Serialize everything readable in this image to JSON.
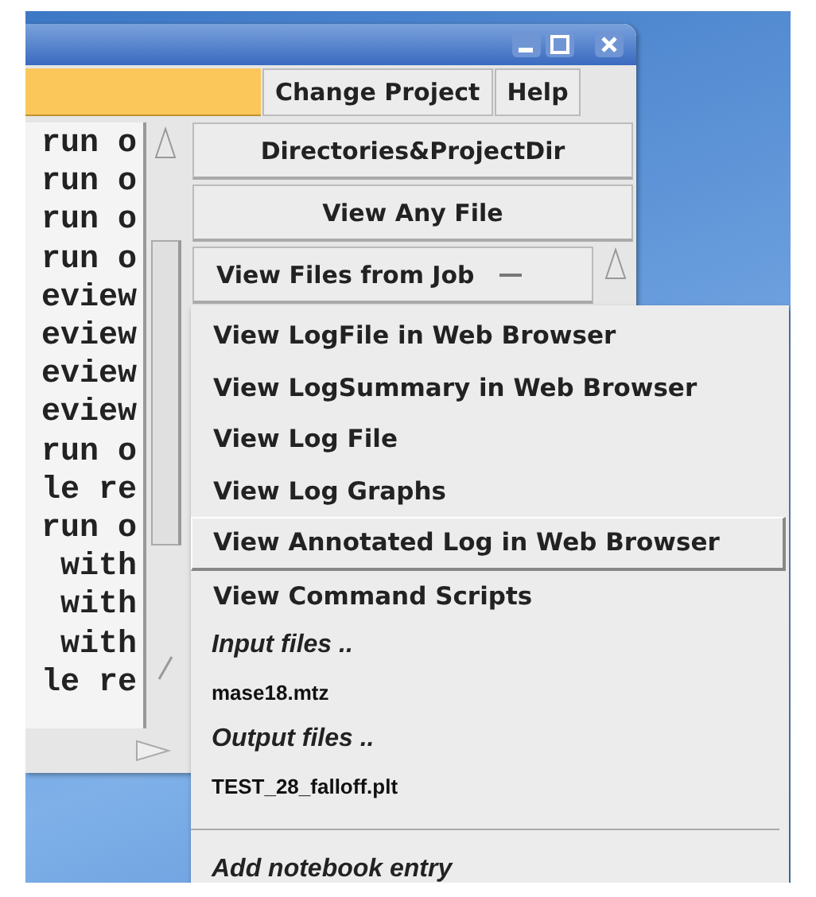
{
  "window": {
    "menu_bar": [
      {
        "label": "Change Project"
      },
      {
        "label": "Help"
      }
    ],
    "log_lines": [
      "run o",
      "run o",
      "run o",
      "run o",
      "eview",
      "eview",
      "eview",
      "eview",
      "run o",
      "le re",
      "run o",
      "with",
      "with",
      "with",
      "le re"
    ],
    "buttons": [
      {
        "label": "Directories&ProjectDir"
      },
      {
        "label": "View Any File"
      }
    ],
    "dropdown": {
      "label": "View Files from Job",
      "expanded": true
    }
  },
  "popup_menu": {
    "items": [
      {
        "kind": "item",
        "label": "View LogFile in Web Browser",
        "selected": false
      },
      {
        "kind": "item",
        "label": "View LogSummary in Web Browser",
        "selected": false
      },
      {
        "kind": "item",
        "label": "View Log File",
        "selected": false
      },
      {
        "kind": "item",
        "label": "View Log Graphs",
        "selected": false
      },
      {
        "kind": "item",
        "label": "View Annotated Log in Web Browser",
        "selected": true
      },
      {
        "kind": "item",
        "label": "View Command Scripts",
        "selected": false
      },
      {
        "kind": "heading",
        "label": "Input files .."
      },
      {
        "kind": "file",
        "label": "mase18.mtz"
      },
      {
        "kind": "heading",
        "label": "Output files .."
      },
      {
        "kind": "file",
        "label": "TEST_28_falloff.plt"
      },
      {
        "kind": "separator"
      },
      {
        "kind": "action",
        "label": "Add notebook entry"
      }
    ]
  }
}
